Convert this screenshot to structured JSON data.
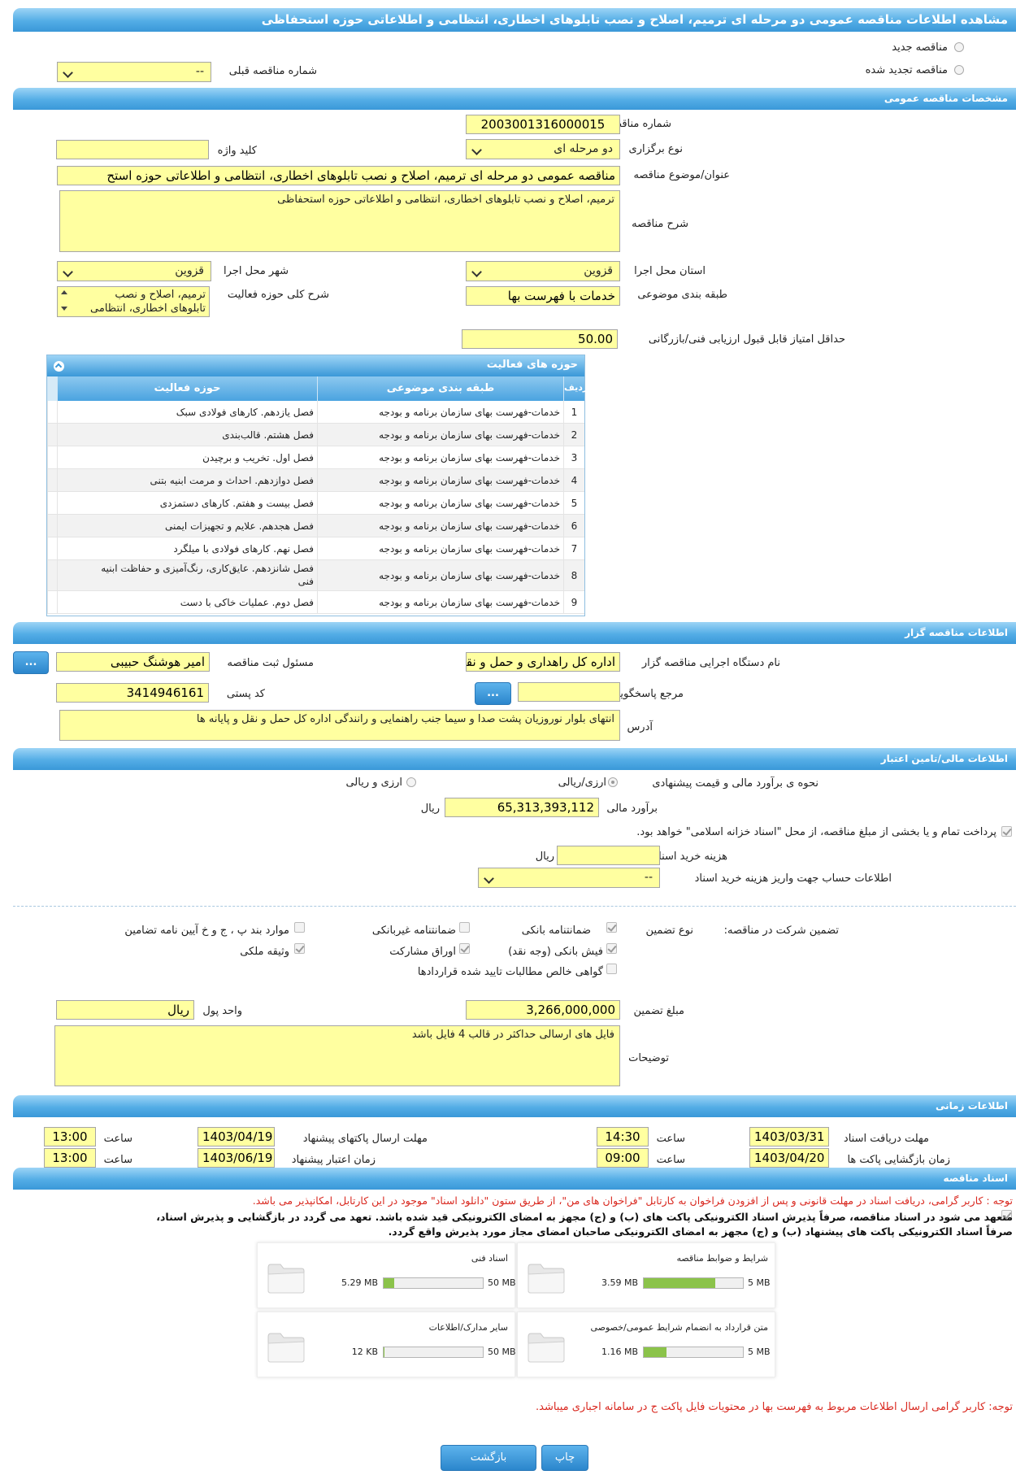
{
  "header": {
    "title": "مشاهده اطلاعات مناقصه عمومی دو مرحله ای ترمیم، اصلاح و نصب تابلوهای اخطاری، انتظامی و اطلاعاتی حوزه استحفاظی"
  },
  "top": {
    "new_tender": "مناقصه جدید",
    "renewed_tender": "مناقصه تجدید شده",
    "prev_number_label": "شماره مناقصه قبلی",
    "prev_number_value": "--"
  },
  "general": {
    "section": "مشخصات مناقصه عمومی",
    "number_label": "شماره مناقصه",
    "number": "2003001316000015",
    "type_label": "نوع برگزاری",
    "type": "دو مرحله ای",
    "keyword_label": "کلید واژه",
    "keyword": "",
    "subject_label": "عنوان/موضوع مناقصه",
    "subject": "مناقصه عمومی دو مرحله ای ترمیم، اصلاح و نصب تابلوهای اخطاری، انتظامی و اطلاعاتی حوزه استح",
    "desc_label": "شرح مناقصه",
    "desc": "ترمیم، اصلاح و نصب تابلوهای اخطاری، انتظامی و اطلاعاتی حوزه استحفاظی",
    "province_label": "استان محل اجرا",
    "province": "قزوین",
    "city_label": "شهر محل اجرا",
    "city": "قزوین",
    "category_label": "طبقه بندی موضوعی",
    "category": "خدمات با فهرست بها",
    "activity_label": "شرح کلی حوزه فعالیت",
    "activity_l1": "ترمیم، اصلاح و نصب",
    "activity_l2": "تابلوهای اخطاری، انتظامی",
    "min_score_label": "حداقل امتیاز قابل قبول ارزیابی فنی/بازرگانی",
    "min_score": "50.00"
  },
  "grid": {
    "title": "حوزه های فعالیت",
    "headers": {
      "row": "ردیف",
      "category": "طبقه بندی موضوعی",
      "field": "حوزه فعالیت"
    },
    "rows": [
      {
        "n": "1",
        "cat": "خدمات-فهرست بهای سازمان برنامه و بودجه",
        "field": "فصل یازدهم. کارهای فولادی سبک"
      },
      {
        "n": "2",
        "cat": "خدمات-فهرست بهای سازمان برنامه و بودجه",
        "field": "فصل هشتم. قالب‌بندی"
      },
      {
        "n": "3",
        "cat": "خدمات-فهرست بهای سازمان برنامه و بودجه",
        "field": "فصل اول. تخریب و برچیدن"
      },
      {
        "n": "4",
        "cat": "خدمات-فهرست بهای سازمان برنامه و بودجه",
        "field": "فصل دوازدهم. احداث و مرمت ابنیه بتنی"
      },
      {
        "n": "5",
        "cat": "خدمات-فهرست بهای سازمان برنامه و بودجه",
        "field": "فصل بیست و هفتم. کارهای دستمزدی"
      },
      {
        "n": "6",
        "cat": "خدمات-فهرست بهای سازمان برنامه و بودجه",
        "field": "فصل هجدهم. علایم و تجهیزات ایمنی"
      },
      {
        "n": "7",
        "cat": "خدمات-فهرست بهای سازمان برنامه و بودجه",
        "field": "فصل نهم. کارهای فولادی با میلگرد"
      },
      {
        "n": "8",
        "cat": "خدمات-فهرست بهای سازمان برنامه و بودجه",
        "field": "فصل شانزدهم. عایق‌کاری، رنگ‌آمیزی و حفاظت ابنیه",
        "field2": "فنی"
      },
      {
        "n": "9",
        "cat": "خدمات-فهرست بهای سازمان برنامه و بودجه",
        "field": "فصل دوم. عملیات خاکی با دست"
      }
    ]
  },
  "organizer": {
    "section": "اطلاعات مناقصه گزار",
    "org_label": "نام دستگاه اجرایی مناقصه گزار",
    "org": "اداره کل راهداری و حمل و نقل",
    "responsible_label": "مسئول ثبت مناقصه",
    "responsible": "امیر هوشنگ حبیبی",
    "reference_label": "مرجع پاسخگویی",
    "reference": "",
    "postal_label": "کد پستی",
    "postal": "3414946161",
    "address_label": "آدرس",
    "address": "انتهای بلوار نوروزیان پشت صدا و سیما جنب راهنمایی و رانندگی اداره کل حمل و نقل و پایانه ها",
    "more_btn": "..."
  },
  "finance": {
    "section": "اطلاعات مالی/تامین اعتبار",
    "method_label": "نحوه ی برآورد مالی و قیمت پیشنهادی",
    "opt1": "ارزی/ریالی",
    "opt2": "ارزی و ریالی",
    "estimate_label": "برآورد مالی",
    "estimate": "65,313,393,112",
    "rial": "ریال",
    "treasury": "پرداخت تمام و یا بخشی از مبلغ مناقصه، از محل \"اسناد خزانه اسلامی\" خواهد بود.",
    "doc_fee_label": "هزینه خرید اسناد",
    "doc_fee": "",
    "account_label": "اطلاعات حساب جهت واریز هزینه خرید اسناد",
    "account": "--"
  },
  "guarantee": {
    "label": "تضمین شرکت در مناقصه:",
    "type_label": "نوع تضمین",
    "bank_guarantee": "ضمانتنامه بانکی",
    "nonbank_guarantee": "ضمانتنامه غیربانکی",
    "clause_items": "موارد بند پ ، ج و خ آیین نامه تضامین",
    "bank_receipt": "فیش بانکی (وجه نقد)",
    "bonds": "اوراق مشارکت",
    "property": "وثیقه ملکی",
    "certificate": "گواهی خالص مطالبات تایید شده قراردادها",
    "amount_label": "مبلغ تضمین",
    "amount": "3,266,000,000",
    "currency_label": "واحد پول",
    "currency": "ریال",
    "notes_label": "توضیحات",
    "notes": "فایل های ارسالی حداکثر در قالب 4 فایل باشد"
  },
  "timing": {
    "section": "اطلاعات زمانی",
    "doc_receive_label": "مهلت دریافت اسناد",
    "doc_receive": "1403/03/31",
    "time_label": "ساعت",
    "doc_receive_time": "14:30",
    "send_label": "مهلت ارسال پاکتهای پیشنهاد",
    "send": "1403/04/19",
    "send_time": "13:00",
    "open_label": "زمان بازگشایی پاکت ها",
    "open": "1403/04/20",
    "open_time": "09:00",
    "validity_label": "زمان اعتبار پیشنهاد",
    "validity": "1403/06/19",
    "validity_time": "13:00"
  },
  "docs": {
    "section": "اسناد مناقصه",
    "notice": "توجه : کاربر گرامی، دریافت اسناد در مهلت قانونی و پس از افزودن فراخوان به کارتابل \"فراخوان های من\"، از طریق ستون \"دانلود اسناد\" موجود در این کارتابل، امکانپذیر می باشد.",
    "commit1": "متعهد می شود در اسناد مناقصه، صرفاً پذیرش اسناد الکترونیکی پاکت های (ب) و (ج) مجهز به امضای الکترونیکی قید شده باشد. تعهد می گردد در بازگشایی و پذیرش اسناد،",
    "commit2": "صرفاً اسناد الکترونیکی پاکت های پیشنهاد (ب) و (ج) مجهز به امضای الکترونیکی صاحبان امضای مجاز مورد پذیرش واقع گردد.",
    "files": [
      {
        "name": "شرایط و ضوابط مناقصه",
        "size": "3.59 MB",
        "max": "5 MB",
        "fill": 0.72
      },
      {
        "name": "اسناد فنی",
        "size": "5.29 MB",
        "max": "50 MB",
        "fill": 0.11
      },
      {
        "name": "متن قرارداد به انضمام شرایط عمومی/خصوصی",
        "size": "1.16 MB",
        "max": "5 MB",
        "fill": 0.23
      },
      {
        "name": "سایر مدارک/اطلاعات",
        "size": "12 KB",
        "max": "50 MB",
        "fill": 0.01
      }
    ],
    "price_note": "توجه: کاربر گرامی ارسال اطلاعات مربوط به فهرست بها در محتویات فایل پاکت ج در سامانه اجباری میباشد."
  },
  "actions": {
    "print": "چاپ",
    "back": "بازگشت"
  },
  "colors": {
    "field_bg": "#ffffa0",
    "header_blue": "#3a98d8",
    "red_text": "#d9281f"
  }
}
